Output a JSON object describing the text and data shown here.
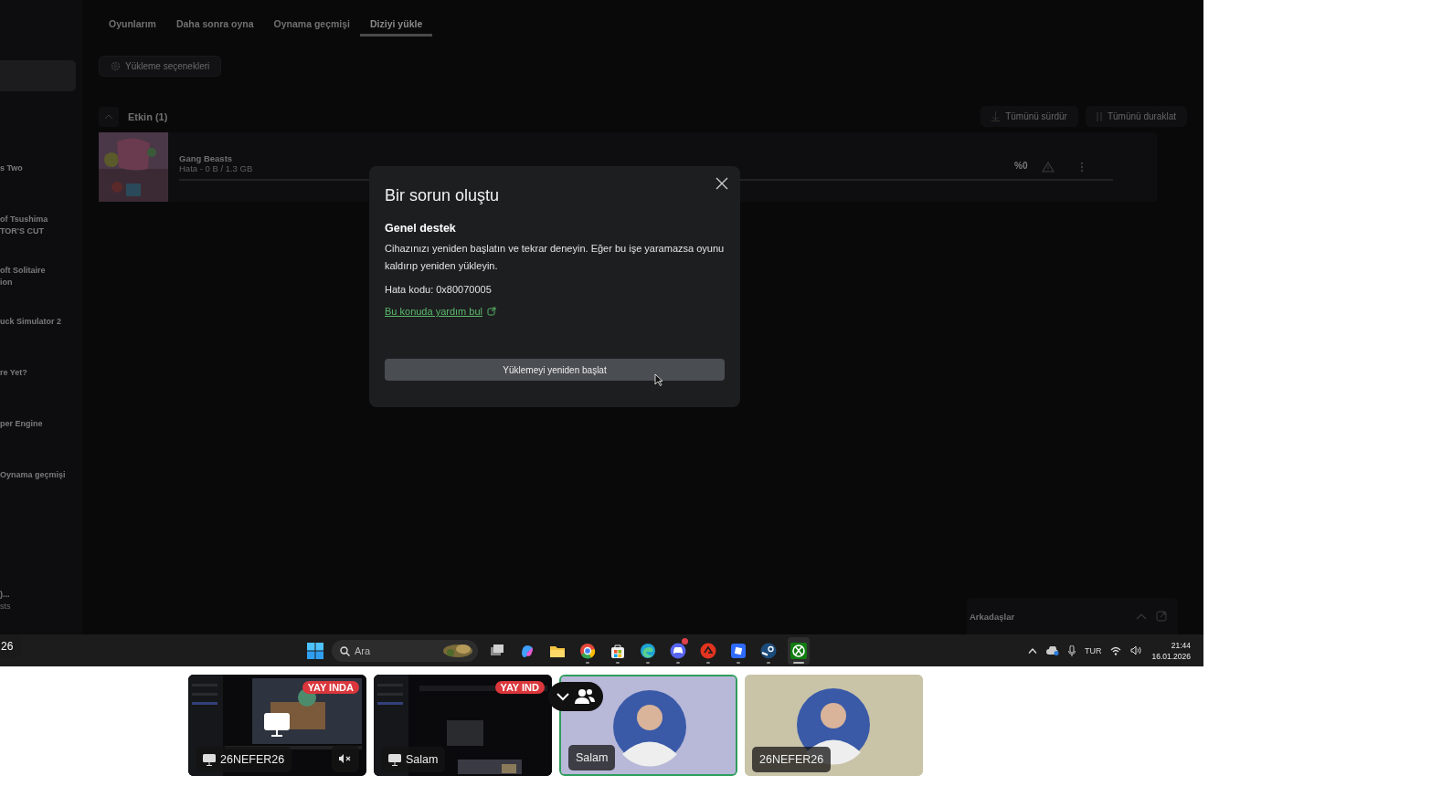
{
  "shared_screen": {
    "sidebar": {
      "items": [
        {
          "lines": [
            "s Two"
          ]
        },
        {
          "lines": [
            "of Tsushima",
            "TOR'S CUT"
          ]
        },
        {
          "lines": [
            "oft Solitaire",
            "ion"
          ]
        },
        {
          "lines": [
            "uck Simulator 2"
          ]
        },
        {
          "lines": [
            "re Yet?"
          ]
        },
        {
          "lines": [
            "per Engine"
          ]
        },
        {
          "lines": [
            "Oynama geçmişi"
          ]
        },
        {
          "lines": [
            ")..."
          ],
          "subtitle": "sts"
        }
      ]
    },
    "tabs": [
      {
        "label": "Oyunlarım",
        "selected": false
      },
      {
        "label": "Daha sonra oyna",
        "selected": false
      },
      {
        "label": "Oynama geçmişi",
        "selected": false
      },
      {
        "label": "Diziyi yükle",
        "selected": true
      }
    ],
    "options_button": "Yükleme seçenekleri",
    "section": {
      "title": "Etkin (1)",
      "expanded": true
    },
    "actions": [
      "Tümünü sürdür",
      "Tümünü duraklat"
    ],
    "downloads": [
      {
        "title": "Gang Beasts",
        "status": "Hata - 0 B / 1.3 GB",
        "level": 0,
        "percent": "%0"
      }
    ],
    "friends_panel": {
      "title": "Arkadaşlar"
    },
    "dialog": {
      "title": "Bir sorun oluştu",
      "heading": "Genel destek",
      "body": "Cihazınızı yeniden başlatın ve tekrar deneyin. Eğer bu işe yaramazsa oyunu kaldırıp yeniden yükleyin.",
      "error_code": "Hata kodu: 0x80070005",
      "link": "Bu konuda yardım bul",
      "button": "Yüklemeyi yeniden başlat"
    },
    "corner_label": "26",
    "taskbar": {
      "search_placeholder": "Ara",
      "apps": [
        {
          "kind": "taskview",
          "running": false,
          "active": false
        },
        {
          "kind": "swirl",
          "running": false,
          "active": false
        },
        {
          "kind": "folder",
          "running": false,
          "active": false
        },
        {
          "kind": "ring",
          "running": true,
          "active": false
        },
        {
          "kind": "bag",
          "running": true,
          "active": false
        },
        {
          "kind": "wave",
          "running": true,
          "active": false
        },
        {
          "kind": "controller",
          "running": true,
          "active": false,
          "notification": true
        },
        {
          "kind": "red",
          "running": true,
          "active": false
        },
        {
          "kind": "square",
          "running": true,
          "active": false
        },
        {
          "kind": "steam",
          "running": true,
          "active": false
        },
        {
          "kind": "xbox",
          "running": true,
          "active": true
        }
      ],
      "language": "TUR",
      "time": "21:44",
      "date": "16.01.2026"
    }
  },
  "tiles": [
    {
      "kind": "screen",
      "label": "26NEFER26",
      "badge": "YAY INDA",
      "muted": true,
      "selected": false
    },
    {
      "kind": "screen",
      "label": "Salam",
      "badge": "YAY IND",
      "muted": false,
      "selected": false
    },
    {
      "kind": "avatar",
      "label": "Salam",
      "selected": true,
      "color": "#b8b8d8"
    },
    {
      "kind": "avatar",
      "label": "26NEFER26",
      "selected": false,
      "color": "#c9c3a8"
    }
  ]
}
